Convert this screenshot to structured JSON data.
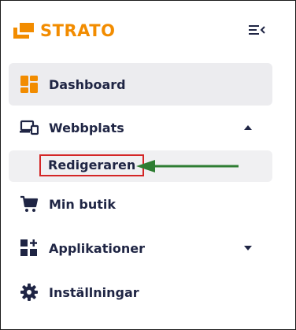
{
  "brand": {
    "name": "STRATO",
    "color": "#f28c00",
    "icon": "strato-logo-icon"
  },
  "toolbar": {
    "menu_toggle_icon": "collapse-menu-icon"
  },
  "nav": {
    "items": [
      {
        "label": "Dashboard",
        "icon": "dashboard-icon",
        "active": true
      },
      {
        "label": "Webbplats",
        "icon": "website-icon",
        "expanded": true,
        "submenu": [
          {
            "label": "Redigeraren",
            "highlighted": true
          }
        ]
      },
      {
        "label": "Min butik",
        "icon": "cart-icon"
      },
      {
        "label": "Applikationer",
        "icon": "apps-icon",
        "expanded": false
      },
      {
        "label": "Inställningar",
        "icon": "gear-icon"
      }
    ]
  },
  "annotation": {
    "arrow_color": "#2e7d32",
    "highlight_color": "#d42626"
  }
}
